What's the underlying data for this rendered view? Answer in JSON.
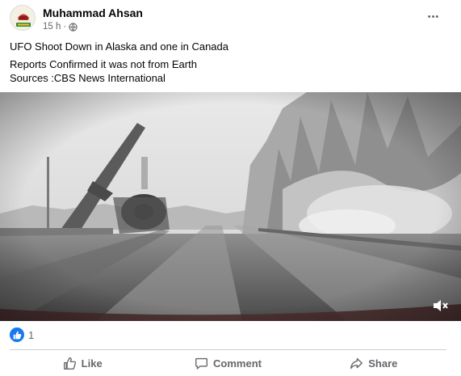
{
  "post": {
    "author": "Muhammad Ahsan",
    "time": "15 h",
    "dot": "·",
    "more_label": "•••",
    "text_lines": [
      "UFO Shoot Down in Alaska and one in Canada",
      "Reports Confirmed it was not from Earth",
      "Sources :CBS News International"
    ]
  },
  "reactions": {
    "count": "1"
  },
  "actions": {
    "like": "Like",
    "comment": "Comment",
    "share": "Share"
  },
  "icons": {
    "avatar": "profile-logo-icon",
    "privacy": "globe-icon",
    "menu": "more-options-icon",
    "mute": "speaker-muted-icon",
    "like": "thumbs-up-icon",
    "comment": "comment-bubble-icon",
    "share": "share-arrow-icon"
  },
  "colors": {
    "brand": "#1877f2",
    "secondary_text": "#65676b"
  }
}
